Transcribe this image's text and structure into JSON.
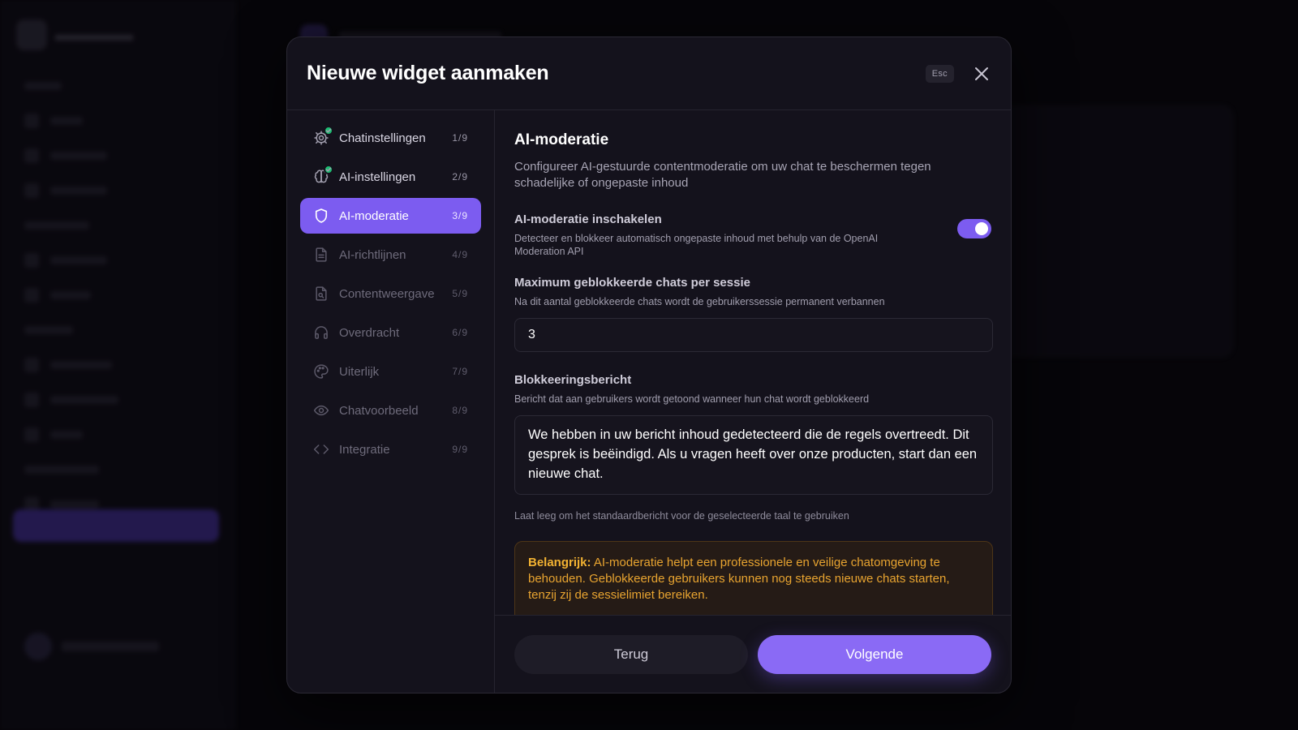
{
  "modal": {
    "title": "Nieuwe widget aanmaken",
    "esc_label": "Esc"
  },
  "steps": [
    {
      "label": "Chatinstellingen",
      "num": "1/9",
      "state": "done",
      "icon": "gear-icon"
    },
    {
      "label": "AI-instellingen",
      "num": "2/9",
      "state": "done",
      "icon": "brain-icon"
    },
    {
      "label": "AI-moderatie",
      "num": "3/9",
      "state": "active",
      "icon": "shield-icon"
    },
    {
      "label": "AI-richtlijnen",
      "num": "4/9",
      "state": "todo",
      "icon": "document-icon"
    },
    {
      "label": "Contentweergave",
      "num": "5/9",
      "state": "todo",
      "icon": "file-search-icon"
    },
    {
      "label": "Overdracht",
      "num": "6/9",
      "state": "todo",
      "icon": "headphones-icon"
    },
    {
      "label": "Uiterlijk",
      "num": "7/9",
      "state": "todo",
      "icon": "palette-icon"
    },
    {
      "label": "Chatvoorbeeld",
      "num": "8/9",
      "state": "todo",
      "icon": "eye-icon"
    },
    {
      "label": "Integratie",
      "num": "9/9",
      "state": "todo",
      "icon": "code-icon"
    }
  ],
  "content": {
    "title": "AI-moderatie",
    "description": "Configureer AI-gestuurde contentmoderatie om uw chat te beschermen tegen schadelijke of ongepaste inhoud",
    "toggle": {
      "label": "AI-moderatie inschakelen",
      "help": "Detecteer en blokkeer automatisch ongepaste inhoud met behulp van de OpenAI Moderation API",
      "enabled": true
    },
    "max_blocked": {
      "label": "Maximum geblokkeerde chats per sessie",
      "help": "Na dit aantal geblokkeerde chats wordt de gebruikerssessie permanent verbannen",
      "value": "3"
    },
    "block_message": {
      "label": "Blokkeeringsbericht",
      "help": "Bericht dat aan gebruikers wordt getoond wanneer hun chat wordt geblokkeerd",
      "value": "We hebben in uw bericht inhoud gedetecteerd die de regels overtreedt. Dit gesprek is beëindigd. Als u vragen heeft over onze producten, start dan een nieuwe chat.",
      "hint": "Laat leeg om het standaardbericht voor de geselecteerde taal te gebruiken"
    },
    "warning": {
      "strong": "Belangrijk:",
      "text": " AI-moderatie helpt een professionele en veilige chatomgeving te behouden. Geblokkeerde gebruikers kunnen nog steeds nieuwe chats starten, tenzij zij de sessielimiet bereiken."
    }
  },
  "footer": {
    "back_label": "Terug",
    "next_label": "Volgende"
  },
  "colors": {
    "accent": "#7c5cf0",
    "check": "#1dbf73",
    "warning_text": "#e8a430"
  }
}
